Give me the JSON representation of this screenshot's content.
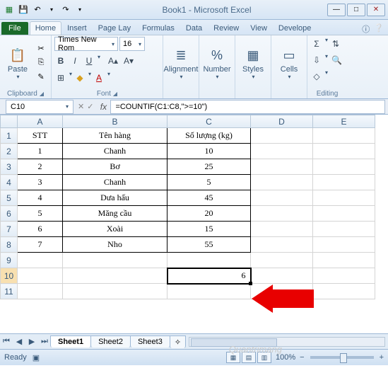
{
  "window": {
    "title": "Book1 - Microsoft Excel",
    "min": "—",
    "max": "□",
    "close": "✕"
  },
  "qat": {
    "save": "💾",
    "undo": "↶",
    "redo": "↷",
    "dd": "▾"
  },
  "tabs": {
    "file": "File",
    "list": [
      "Home",
      "Insert",
      "Page Lay",
      "Formulas",
      "Data",
      "Review",
      "View",
      "Develope"
    ],
    "active": "Home",
    "help1": "ⓘ",
    "help2": "❔"
  },
  "ribbon": {
    "clipboard": {
      "label": "Clipboard",
      "paste": "Paste",
      "cut": "✂",
      "copy": "⎘",
      "brush": "✎"
    },
    "font": {
      "label": "Font",
      "name": "Times New Rom",
      "size": "16",
      "grow": "A▴",
      "shrink": "A▾",
      "bold": "B",
      "italic": "I",
      "underline": "U",
      "border": "⊞",
      "fill": "◆",
      "color": "A"
    },
    "alignment": {
      "label": "Alignment",
      "icon": "≣"
    },
    "number": {
      "label": "Number",
      "icon": "%"
    },
    "styles": {
      "label": "Styles",
      "icon": "▦"
    },
    "cells": {
      "label": "Cells",
      "icon": "▭"
    },
    "editing": {
      "label": "Editing",
      "sum": "Σ",
      "fill": "⇩",
      "clear": "◇",
      "sort": "⇅",
      "find": "🔍"
    }
  },
  "namebox": "C10",
  "formula": "=COUNTIF(C1:C8,\">=10\")",
  "columns": [
    "A",
    "B",
    "C",
    "D",
    "E"
  ],
  "headers": {
    "a": "STT",
    "b": "Tên hàng",
    "c": "Số lượng (kg)"
  },
  "rows": [
    {
      "n": "1",
      "a": "1",
      "b": "Chanh",
      "c": "10"
    },
    {
      "n": "2",
      "a": "2",
      "b": "Bơ",
      "c": "25"
    },
    {
      "n": "3",
      "a": "3",
      "b": "Chanh",
      "c": "5"
    },
    {
      "n": "4",
      "a": "4",
      "b": "Dưa hấu",
      "c": "45"
    },
    {
      "n": "5",
      "a": "5",
      "b": "Măng cầu",
      "c": "20"
    },
    {
      "n": "6",
      "a": "6",
      "b": "Xoài",
      "c": "15"
    },
    {
      "n": "7",
      "a": "7",
      "b": "Nho",
      "c": "55"
    }
  ],
  "result": "6",
  "sheets": [
    "Sheet1",
    "Sheet2",
    "Sheet3"
  ],
  "status": {
    "ready": "Ready",
    "zoom": "100%",
    "minus": "−",
    "plus": "+"
  },
  "watermark": "Quantrimang"
}
